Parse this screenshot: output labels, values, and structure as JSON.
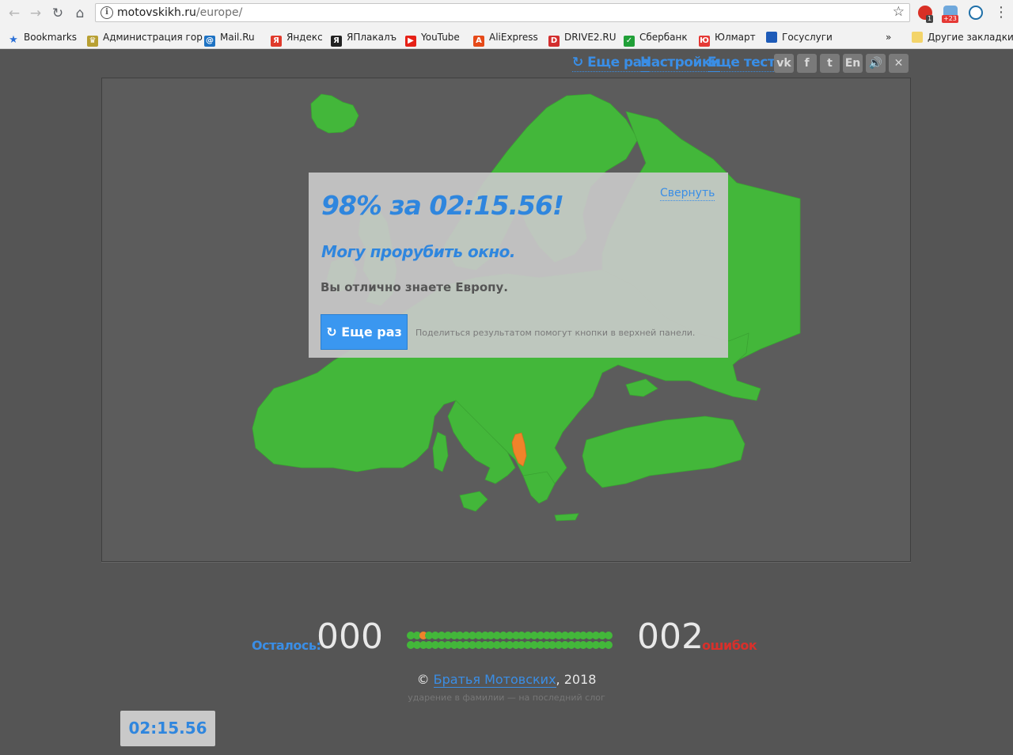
{
  "browser": {
    "url_host": "motovskikh.ru",
    "url_path": "/europe/",
    "ext_badge_1": "1",
    "ext_badge_2": "+23",
    "bookmarks": [
      {
        "label": "Bookmarks",
        "icon": "star-icon",
        "color": "#2a6fd6"
      },
      {
        "label": "Администрация гор",
        "icon": "crest-icon",
        "color": "#b8a033"
      },
      {
        "label": "Mail.Ru",
        "icon": "at-icon",
        "color": "#1e73c4"
      },
      {
        "label": "Яндекс",
        "icon": "yandex-icon",
        "color": "#e03a2c"
      },
      {
        "label": "ЯПлакалъ",
        "icon": "yaplakal-icon",
        "color": "#222222"
      },
      {
        "label": "YouTube",
        "icon": "youtube-icon",
        "color": "#e62117"
      },
      {
        "label": "AliExpress",
        "icon": "aliexpress-icon",
        "color": "#e64a19"
      },
      {
        "label": "DRIVE2.RU",
        "icon": "drive2-icon",
        "color": "#d32f2f"
      },
      {
        "label": "Сбербанк",
        "icon": "sberbank-icon",
        "color": "#21a038"
      },
      {
        "label": "Юлмарт",
        "icon": "ulmart-icon",
        "color": "#e53935"
      },
      {
        "label": "Госуслуги",
        "icon": "flag-icon",
        "color": "#1e5bb8"
      }
    ],
    "more_label": "»",
    "other_bookmarks": "Другие закладки"
  },
  "toplinks": {
    "again": "↻ Еще раз",
    "settings": "Настройки",
    "more_tests": "Еще тесты",
    "social": [
      "vk-icon",
      "facebook-icon",
      "twitter-icon",
      "en-icon",
      "sound-icon",
      "close-icon"
    ],
    "social_labels": [
      "vk",
      "f",
      "t",
      "En",
      "🔊",
      "✕"
    ]
  },
  "result": {
    "title": "98% за 02:15.56!",
    "collapse": "Свернуть",
    "rank": "Могу прорубить окно.",
    "description": "Вы отлично знаете Европу.",
    "again_button": "↻ Еще раз",
    "share_note": "Поделиться результатом помогут кнопки в верхней панели."
  },
  "stats": {
    "remaining_label": "Осталось:",
    "remaining_count": "000",
    "errors_count": "002",
    "errors_label": "ошибок",
    "dot_rows": [
      [
        "g",
        "g",
        "o",
        "g",
        "g",
        "g",
        "g",
        "g",
        "g",
        "g",
        "g",
        "g",
        "g",
        "g",
        "g",
        "g",
        "g",
        "g",
        "g",
        "g",
        "g",
        "g",
        "g",
        "g",
        "g",
        "g",
        "g",
        "g",
        "g",
        "g",
        "g",
        "g",
        "g"
      ],
      [
        "g",
        "g",
        "g",
        "g",
        "g",
        "g",
        "g",
        "g",
        "g",
        "g",
        "g",
        "g",
        "g",
        "g",
        "g",
        "g",
        "g",
        "g",
        "g",
        "g",
        "g",
        "g",
        "g",
        "g",
        "g",
        "g",
        "g",
        "g",
        "g",
        "g",
        "g",
        "g",
        "g"
      ]
    ]
  },
  "footer": {
    "copy": "©",
    "author": "Братья Мотовских",
    "year": ", 2018",
    "stress_note": "ударение в фамилии — на последний слог"
  },
  "timer": "02:15.56",
  "colors": {
    "land": "#43b73a",
    "wrong": "#f0832a",
    "accent": "#3a8ee6",
    "error": "#d8302b"
  }
}
